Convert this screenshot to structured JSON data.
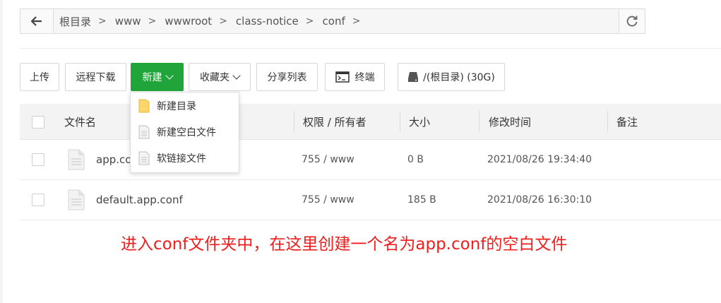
{
  "breadcrumb": {
    "items": [
      "根目录",
      "www",
      "wwwroot",
      "class-notice",
      "conf"
    ],
    "separator": ">"
  },
  "toolbar": {
    "upload": "上传",
    "remote_download": "远程下载",
    "new": "新建",
    "favorites": "收藏夹",
    "share_list": "分享列表",
    "terminal": "终端",
    "disk": "/(根目录) (30G)"
  },
  "new_menu": {
    "items": [
      {
        "label": "新建目录",
        "icon": "folder-icon"
      },
      {
        "label": "新建空白文件",
        "icon": "file-icon"
      },
      {
        "label": "软链接文件",
        "icon": "file-icon"
      }
    ]
  },
  "table": {
    "columns": [
      "文件名",
      "权限 / 所有者",
      "大小",
      "修改时间",
      "备注"
    ],
    "rows": [
      {
        "name": "app.co",
        "perm": "755 / www",
        "size": "0 B",
        "mtime": "2021/08/26 19:34:40",
        "note": ""
      },
      {
        "name": "default.app.conf",
        "perm": "755 / www",
        "size": "185 B",
        "mtime": "2021/08/26 16:30:10",
        "note": ""
      }
    ]
  },
  "annotation": "进入conf文件夹中，在这里创建一个名为app.conf的空白文件",
  "colors": {
    "accent_green": "#20a53a",
    "annotation_red": "#f01d1d"
  }
}
